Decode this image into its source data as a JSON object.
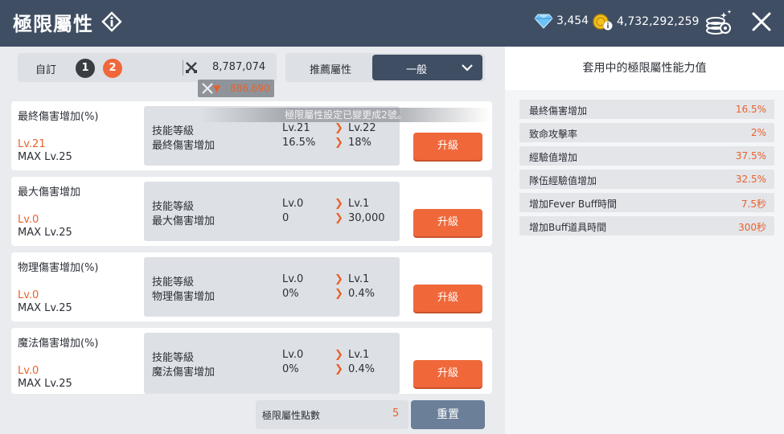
{
  "header": {
    "title": "極限屬性",
    "diamonds": "3,454",
    "gold": "4,732,292,259"
  },
  "preset": {
    "label": "自訂",
    "slots": [
      "1",
      "2"
    ],
    "active_slot": "2",
    "combat_power": "8,787,074",
    "power_change": "886,690"
  },
  "recommend": {
    "label": "推薦屬性",
    "selected": "一般"
  },
  "toast": "極限屬性設定已變更成2號。",
  "attributes": [
    {
      "name": "最終傷害增加(%)",
      "lv": "Lv.21",
      "max": "MAX Lv.25",
      "label1": "技能等級",
      "label2": "最終傷害增加",
      "cur1": "Lv.21",
      "cur2": "16.5%",
      "next1": "Lv.22",
      "next2": "18%",
      "button": "升級"
    },
    {
      "name": "最大傷害增加",
      "lv": "Lv.0",
      "max": "MAX Lv.25",
      "label1": "技能等級",
      "label2": "最大傷害增加",
      "cur1": "Lv.0",
      "cur2": "0",
      "next1": "Lv.1",
      "next2": "30,000",
      "button": "升級"
    },
    {
      "name": "物理傷害增加(%)",
      "lv": "Lv.0",
      "max": "MAX Lv.25",
      "label1": "技能等級",
      "label2": "物理傷害增加",
      "cur1": "Lv.0",
      "cur2": "0%",
      "next1": "Lv.1",
      "next2": "0.4%",
      "button": "升級"
    },
    {
      "name": "魔法傷害增加(%)",
      "lv": "Lv.0",
      "max": "MAX Lv.25",
      "label1": "技能等級",
      "label2": "魔法傷害增加",
      "cur1": "Lv.0",
      "cur2": "0%",
      "next1": "Lv.1",
      "next2": "0.4%",
      "button": "升級"
    }
  ],
  "points": {
    "label": "極限屬性點數",
    "value": "5"
  },
  "reset_label": "重置",
  "applied": {
    "title": "套用中的極限屬性能力值",
    "stats": [
      {
        "name": "最終傷害增加",
        "value": "16.5%"
      },
      {
        "name": "致命攻擊率",
        "value": "2%"
      },
      {
        "name": "經驗值增加",
        "value": "37.5%"
      },
      {
        "name": "隊伍經驗值增加",
        "value": "32.5%"
      },
      {
        "name": "增加Fever Buff時間",
        "value": "7.5秒"
      },
      {
        "name": "增加Buff道具時間",
        "value": "300秒"
      }
    ]
  },
  "colors": {
    "accent": "#f0683a",
    "header": "#3f4e63",
    "highlight_text": "#e8612c"
  }
}
